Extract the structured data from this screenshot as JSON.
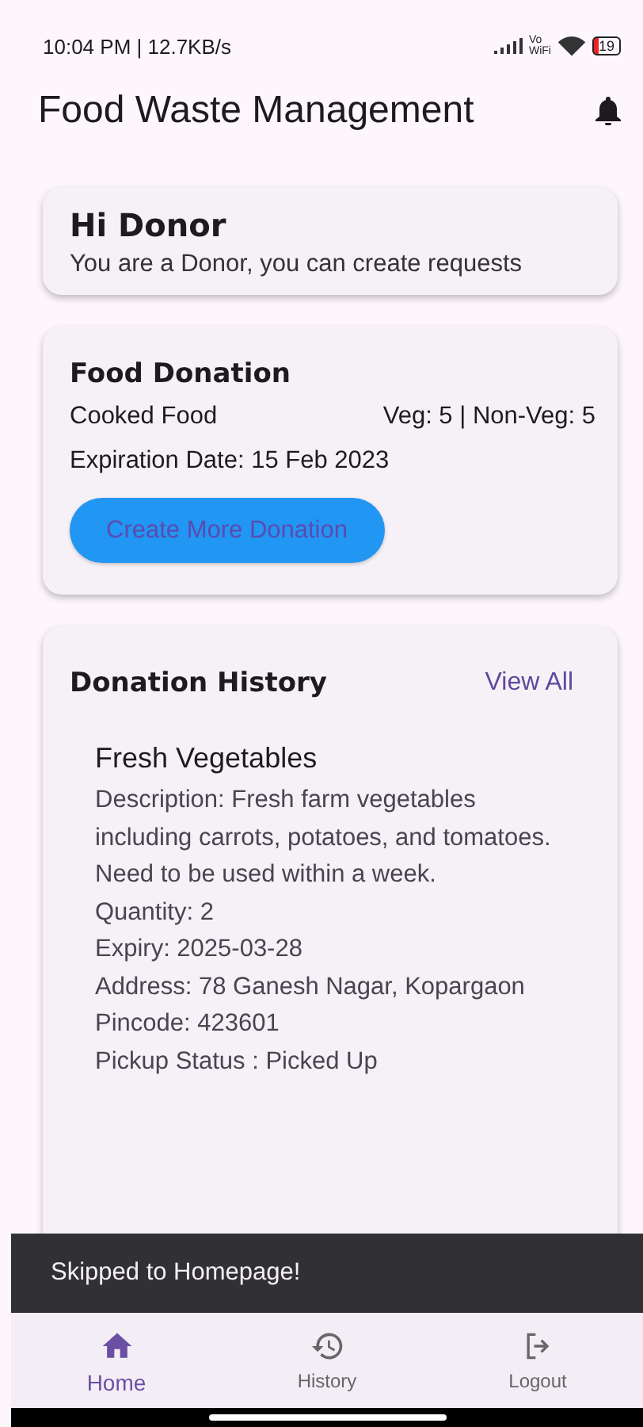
{
  "status_bar": {
    "time": "10:04 PM | 12.7KB/s",
    "vowifi": "Vo",
    "vowifi_sub": "WiFi",
    "battery": "19"
  },
  "app_bar": {
    "title": "Food Waste Management"
  },
  "greeting": {
    "title": "Hi Donor",
    "subtitle": "You are a Donor, you can create requests"
  },
  "food_donation": {
    "title": "Food Donation",
    "type": "Cooked Food",
    "counts": "Veg: 5 | Non-Veg: 5",
    "expiry": "Expiration Date: 15 Feb 2023",
    "button": "Create More Donation"
  },
  "donation_history": {
    "title": "Donation History",
    "link": "View All",
    "items": [
      {
        "name": "Fresh Vegetables",
        "lines": [
          "Description: Fresh farm vegetables including carrots, potatoes, and tomatoes. Need to be used within a week.",
          "Quantity: 2",
          "Expiry: 2025-03-28",
          "Address: 78 Ganesh Nagar, Kopargaon",
          "Pincode: 423601",
          "Pickup Status : Picked Up"
        ]
      }
    ]
  },
  "snackbar": {
    "message": "Skipped to Homepage!"
  },
  "bottom_nav": [
    {
      "kind": "home",
      "label": "Home",
      "selected": true
    },
    {
      "kind": "history",
      "label": "History",
      "selected": false
    },
    {
      "kind": "logout",
      "label": "Logout",
      "selected": false
    }
  ]
}
